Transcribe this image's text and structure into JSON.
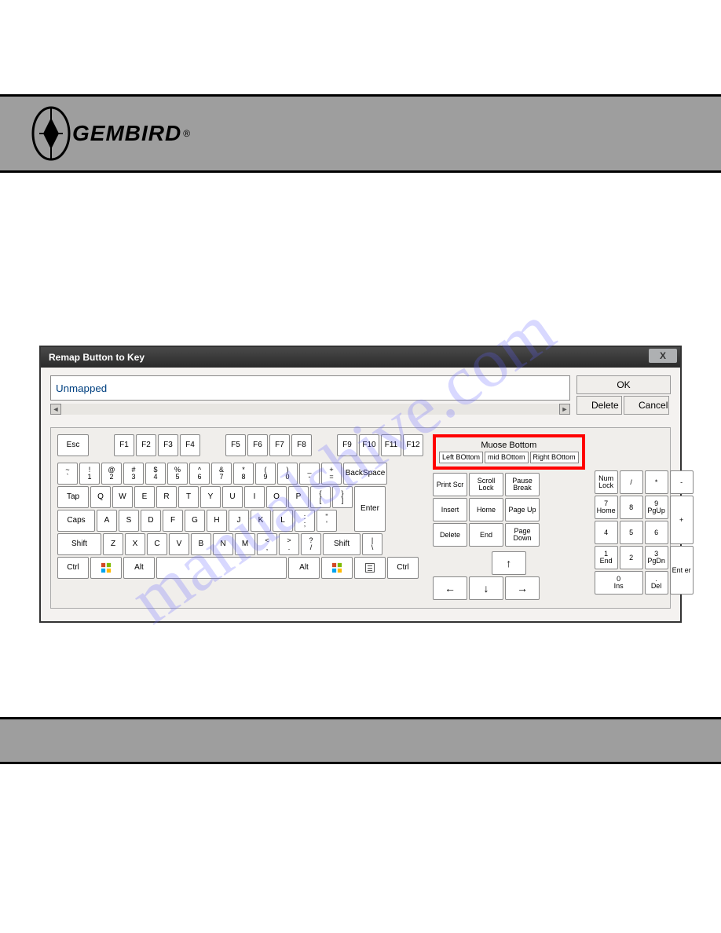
{
  "brand": "GEMBIRD",
  "watermark": "manualshive.com",
  "window": {
    "title": "Remap Button to Key",
    "mapping_value": "Unmapped",
    "close": "X",
    "ok": "OK",
    "delete": "Delete",
    "cancel": "Cancel"
  },
  "mouse": {
    "title": "Muose Bottom",
    "left": "Left BOttom",
    "mid": "mid BOttom",
    "right": "Right BOttom"
  },
  "frow": {
    "esc": "Esc",
    "f1": "F1",
    "f2": "F2",
    "f3": "F3",
    "f4": "F4",
    "f5": "F5",
    "f6": "F6",
    "f7": "F7",
    "f8": "F8",
    "f9": "F9",
    "f10": "F10",
    "f11": "F11",
    "f12": "F12"
  },
  "row1": {
    "k0t": "~",
    "k0b": "`",
    "k1t": "!",
    "k1b": "1",
    "k2t": "@",
    "k2b": "2",
    "k3t": "#",
    "k3b": "3",
    "k4t": "$",
    "k4b": "4",
    "k5t": "%",
    "k5b": "5",
    "k6t": "^",
    "k6b": "6",
    "k7t": "&",
    "k7b": "7",
    "k8t": "*",
    "k8b": "8",
    "k9t": "(",
    "k9b": "9",
    "k10t": ")",
    "k10b": "0",
    "k11t": "_",
    "k11b": "-",
    "k12t": "+",
    "k12b": "=",
    "back": "BackSpace"
  },
  "row2": {
    "tab": "Tap",
    "q": "Q",
    "w": "W",
    "e": "E",
    "r": "R",
    "t": "T",
    "y": "Y",
    "u": "U",
    "i": "I",
    "o": "O",
    "p": "P",
    "br1t": "{",
    "br1b": "[",
    "br2t": "}",
    "br2b": "]",
    "enter": "Enter"
  },
  "row3": {
    "caps": "Caps",
    "a": "A",
    "s": "S",
    "d": "D",
    "f": "F",
    "g": "G",
    "h": "H",
    "j": "J",
    "k": "K",
    "l": "L",
    "sc1t": ":",
    "sc1b": ";",
    "sc2t": "\"",
    "sc2b": "'"
  },
  "row4": {
    "shiftl": "Shift",
    "z": "Z",
    "x": "X",
    "c": "C",
    "v": "V",
    "b": "B",
    "n": "N",
    "m": "M",
    "cm1t": "<",
    "cm1b": ",",
    "cm2t": ">",
    "cm2b": ".",
    "cm3t": "?",
    "cm3b": "/",
    "shiftr": "Shift",
    "bs1t": "|",
    "bs1b": "\\"
  },
  "row5": {
    "ctrll": "Ctrl",
    "altl": "Alt",
    "altr": "Alt",
    "ctrlr": "Ctrl"
  },
  "nav": {
    "prtsc": "Print Scr",
    "scrlk": "Scroll Lock",
    "pause": "Pause Break",
    "ins": "Insert",
    "home": "Home",
    "pgup": "Page Up",
    "del": "Delete",
    "end": "End",
    "pgdn": "Page Down",
    "up": "↑",
    "down": "↓",
    "left": "←",
    "right": "→"
  },
  "num": {
    "numlk": "Num Lock",
    "div": "/",
    "mul": "*",
    "sub": "-",
    "k7t": "7",
    "k7b": "Home",
    "k8": "8",
    "k9t": "9",
    "k9b": "PgUp",
    "add": "+",
    "k4": "4",
    "k5": "5",
    "k6": "6",
    "k1t": "1",
    "k1b": "End",
    "k2": "2",
    "k3t": "3",
    "k3b": "PgDn",
    "ent": "Ent er",
    "k0t": "0",
    "k0b": "Ins",
    "kdott": ".",
    "kdotb": "Del"
  }
}
